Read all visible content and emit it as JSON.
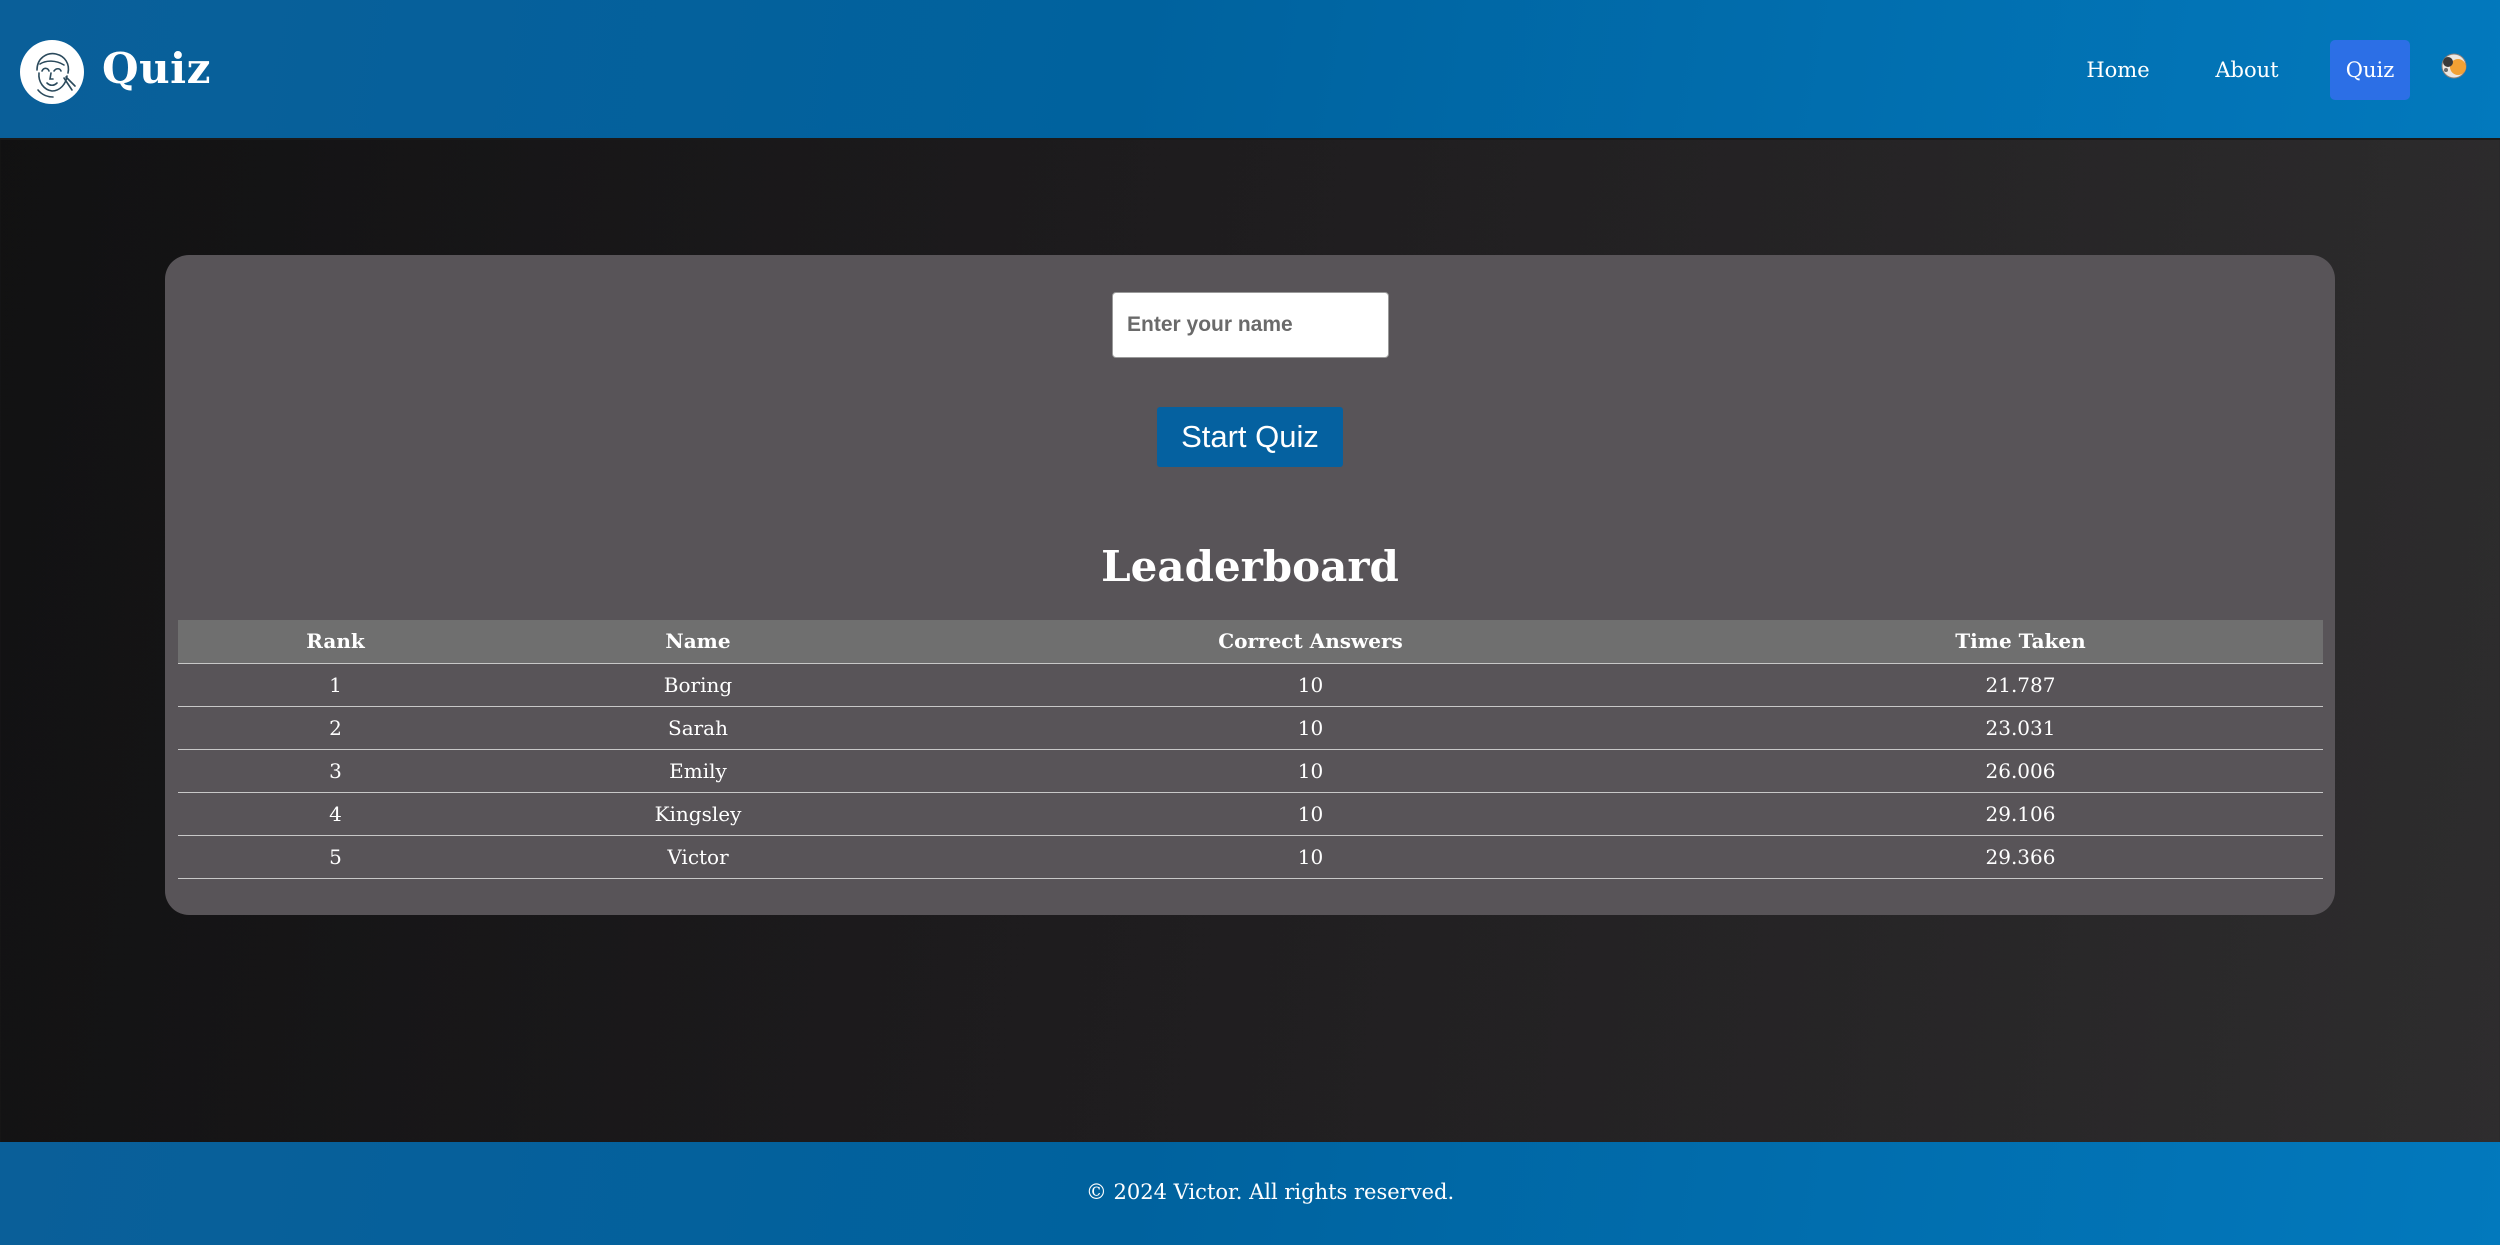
{
  "header": {
    "brand": "Quiz",
    "nav": [
      {
        "label": "Home"
      },
      {
        "label": "About"
      },
      {
        "label": "Quiz",
        "active": true
      }
    ],
    "icons": {
      "logo": "cartoon-portrait-logo",
      "theme_toggle": "sun-moon-icon"
    },
    "colors": {
      "header_bg": "#00629e",
      "active_nav_bg": "#2c6fe6"
    }
  },
  "quiz_form": {
    "name_placeholder": "Enter your name",
    "name_value": "",
    "start_label": "Start Quiz",
    "start_button_color": "#0561a0"
  },
  "leaderboard": {
    "title": "Leaderboard",
    "columns": [
      "Rank",
      "Name",
      "Correct Answers",
      "Time Taken"
    ],
    "rows": [
      [
        "1",
        "Boring",
        "10",
        "21.787"
      ],
      [
        "2",
        "Sarah",
        "10",
        "23.031"
      ],
      [
        "3",
        "Emily",
        "10",
        "26.006"
      ],
      [
        "4",
        "Kingsley",
        "10",
        "29.106"
      ],
      [
        "5",
        "Victor",
        "10",
        "29.366"
      ]
    ]
  },
  "footer": {
    "text": "© 2024 Victor. All rights reserved."
  }
}
